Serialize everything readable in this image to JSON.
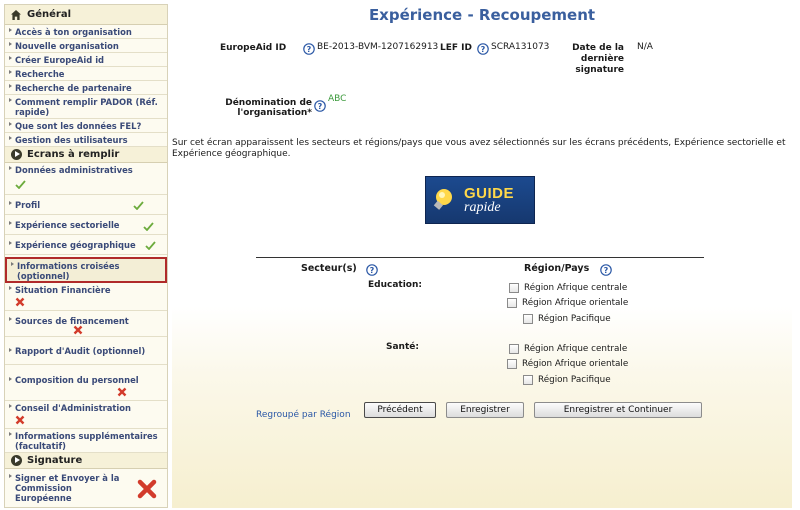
{
  "sidebar": {
    "general_header": "Général",
    "general_items": [
      "Accès à ton organisation",
      "Nouvelle organisation",
      "Créer EuropeAid id",
      "Recherche",
      "Recherche de partenaire",
      "Comment remplir PADOR (Réf. rapide)",
      "Que sont les données FEL?",
      "Gestion des utilisateurs"
    ],
    "ecrans_header": "Ecrans à remplir",
    "ecrans_items": [
      {
        "label": "Données administratives",
        "status": "check"
      },
      {
        "label": "Profil",
        "status": "check"
      },
      {
        "label": "Expérience sectorielle",
        "status": "check"
      },
      {
        "label": "Expérience géographique",
        "status": "check"
      },
      {
        "label": "Informations croisées (optionnel)",
        "status": "none"
      },
      {
        "label": "Situation Financière",
        "status": "cross"
      },
      {
        "label": "Sources de financement",
        "status": "cross"
      },
      {
        "label": "Rapport d'Audit  (optionnel)",
        "status": "none"
      },
      {
        "label": "Composition du personnel",
        "status": "cross"
      },
      {
        "label": "Conseil d'Administration",
        "status": "cross"
      },
      {
        "label": "Informations supplémentaires (facultatif)",
        "status": "none"
      }
    ],
    "signature_header": "Signature",
    "signature_items": [
      {
        "label": "Signer et Envoyer à la Commission Européenne",
        "status": "cross-big"
      }
    ]
  },
  "main": {
    "title": "Expérience - Recoupement",
    "europeaid_label": "EuropeAid ID",
    "europeaid_value": "BE-2013-BVM-1207162913",
    "lef_label": "LEF ID",
    "lef_value": "SCRA131073",
    "date_label": "Date de la dernière signature",
    "date_value": "N/A",
    "denomination_label": "Dénomination de l'organisation*",
    "denomination_value": "ABC",
    "intro": "Sur cet écran apparaissent les secteurs et régions/pays que vous avez sélectionnés sur les écrans précédents, Expérience sectorielle et Expérience géographique.",
    "guide_line1": "GUIDE",
    "guide_line2": "rapide",
    "col_secteur": "Secteur(s)",
    "col_region": "Région/Pays",
    "sectors": [
      {
        "name": "Education:",
        "regions": [
          "Région Afrique centrale",
          "Région Afrique orientale",
          "Région Pacifique"
        ]
      },
      {
        "name": "Santé:",
        "regions": [
          "Région Afrique centrale",
          "Région Afrique orientale",
          "Région Pacifique"
        ]
      }
    ],
    "regroup_link": "Regroupé par Région",
    "btn_prev": "Précédent",
    "btn_save": "Enregistrer",
    "btn_save_continue": "Enregistrer et Continuer"
  },
  "colors": {
    "title": "#3a5f9e",
    "nav_text": "#3a4a78",
    "active_border": "#b02a2a",
    "check": "#6cab3c",
    "cross": "#d23b2b",
    "sidebar_bg": "#fdfbf0"
  },
  "icons": [
    "home-icon",
    "section-arrow-icon",
    "check-icon",
    "cross-icon",
    "help-icon",
    "lightbulb-icon"
  ]
}
